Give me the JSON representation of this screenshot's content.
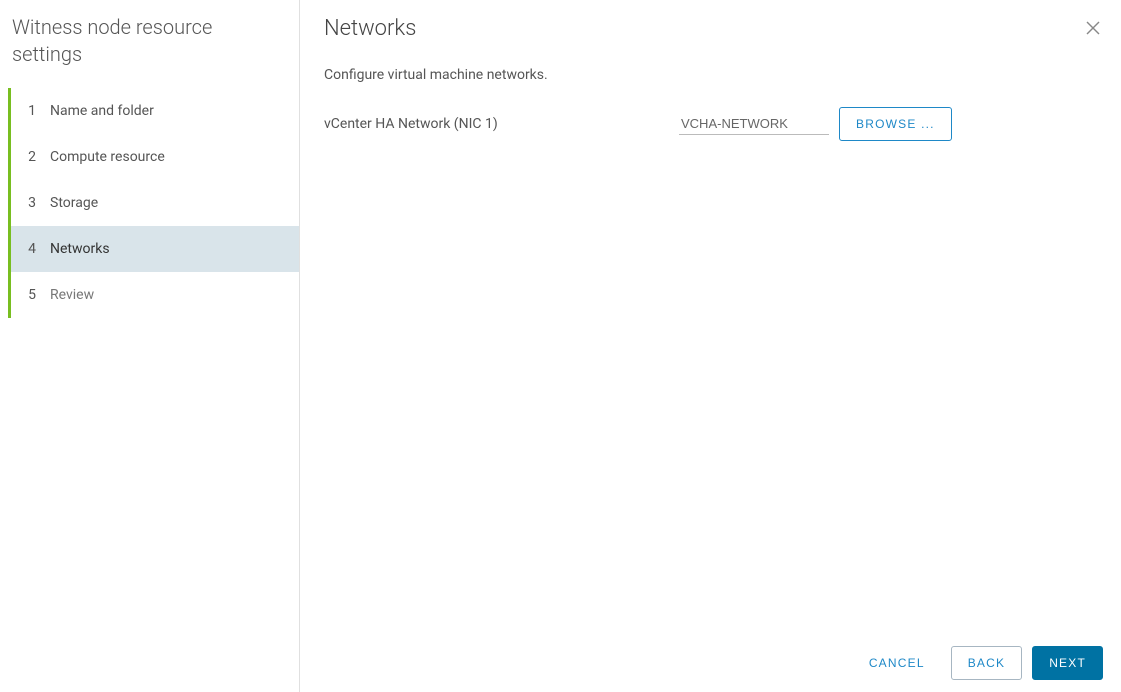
{
  "wizard": {
    "title": "Witness node resource settings",
    "steps": [
      {
        "num": "1",
        "label": "Name and folder",
        "state": "done"
      },
      {
        "num": "2",
        "label": "Compute resource",
        "state": "done"
      },
      {
        "num": "3",
        "label": "Storage",
        "state": "done"
      },
      {
        "num": "4",
        "label": "Networks",
        "state": "active"
      },
      {
        "num": "5",
        "label": "Review",
        "state": "future"
      }
    ]
  },
  "page": {
    "heading": "Networks",
    "subtitle": "Configure virtual machine networks."
  },
  "form": {
    "nic1": {
      "label": "vCenter HA Network (NIC 1)",
      "value": "VCHA-NETWORK",
      "browse_label": "BROWSE ..."
    }
  },
  "footer": {
    "cancel": "CANCEL",
    "back": "BACK",
    "next": "NEXT"
  }
}
